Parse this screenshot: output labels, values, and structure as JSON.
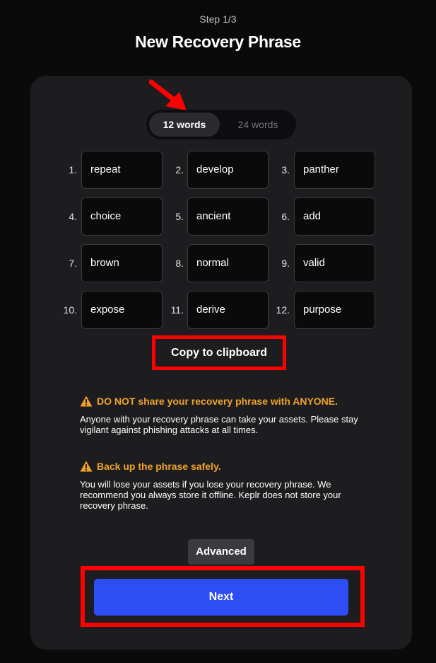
{
  "header": {
    "step": "Step 1/3",
    "title": "New Recovery Phrase"
  },
  "toggle": {
    "options": [
      "12 words",
      "24 words"
    ],
    "selected": "12 words"
  },
  "words": [
    {
      "num": "1.",
      "word": "repeat"
    },
    {
      "num": "2.",
      "word": "develop"
    },
    {
      "num": "3.",
      "word": "panther"
    },
    {
      "num": "4.",
      "word": "choice"
    },
    {
      "num": "5.",
      "word": "ancient"
    },
    {
      "num": "6.",
      "word": "add"
    },
    {
      "num": "7.",
      "word": "brown"
    },
    {
      "num": "8.",
      "word": "normal"
    },
    {
      "num": "9.",
      "word": "valid"
    },
    {
      "num": "10.",
      "word": "expose"
    },
    {
      "num": "11.",
      "word": "derive"
    },
    {
      "num": "12.",
      "word": "purpose"
    }
  ],
  "copy_label": "Copy to clipboard",
  "warnings": [
    {
      "icon": "warning-icon",
      "title": "DO NOT share your recovery phrase with ANYONE.",
      "body": "Anyone with your recovery phrase can take your assets. Please stay vigilant against phishing attacks at all times."
    },
    {
      "icon": "warning-icon",
      "title": "Back up the phrase safely.",
      "body": "You will lose your assets if you lose your recovery phrase. We recommend you always store it offline. Keplr does not store your recovery phrase."
    }
  ],
  "advanced_label": "Advanced",
  "next_label": "Next",
  "colors": {
    "accent": "#2d4ef5",
    "warning": "#f0a22b",
    "annotation": "#ff0000"
  }
}
